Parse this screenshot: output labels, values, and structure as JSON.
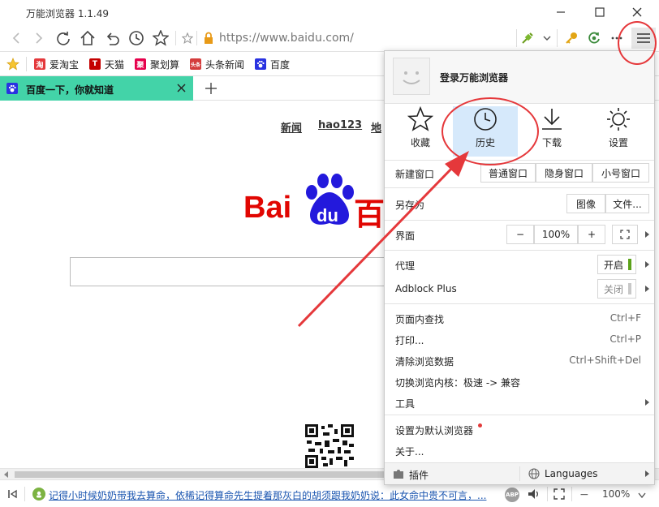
{
  "window": {
    "title": "万能浏览器 1.1.49"
  },
  "nav": {
    "url": "https://www.baidu.com/"
  },
  "bookmarks": [
    {
      "label": "爱淘宝",
      "icon": "taobao-icon",
      "glyph": "淘",
      "color": "#e4393c"
    },
    {
      "label": "天猫",
      "icon": "tmall-icon",
      "glyph": "T",
      "color": "#c40000"
    },
    {
      "label": "聚划算",
      "icon": "juhuasuan-icon",
      "glyph": "聚",
      "color": "#e6004c"
    },
    {
      "label": "头条新闻",
      "icon": "toutiao-icon",
      "glyph": "头条",
      "color": "#d43d3d"
    },
    {
      "label": "百度",
      "icon": "baidu-paw-icon",
      "glyph": "",
      "color": "#2932e1"
    }
  ],
  "tab": {
    "title": "百度一下，你就知道"
  },
  "page": {
    "links": [
      "新闻",
      "hao123",
      "地"
    ],
    "logo_text_left": "Bai",
    "logo_text_du": "du",
    "logo_text_right": "百"
  },
  "status": {
    "news": "记得小时候奶奶带我去算命，依稀记得算命先生提着那灰白的胡须跟我奶奶说：此女命中贵不可言，...",
    "zoom": "100%"
  },
  "menu": {
    "login": "登录万能浏览器",
    "quick": [
      {
        "label": "收藏",
        "icon": "star-icon"
      },
      {
        "label": "历史",
        "icon": "clock-icon"
      },
      {
        "label": "下载",
        "icon": "download-icon"
      },
      {
        "label": "设置",
        "icon": "sun-gear-icon"
      }
    ],
    "new_window_label": "新建窗口",
    "new_window_opts": [
      "普通窗口",
      "隐身窗口",
      "小号窗口"
    ],
    "save_as_label": "另存为",
    "save_as_opts": [
      "图像",
      "文件..."
    ],
    "interface_label": "界面",
    "zoom_minus": "−",
    "zoom_value": "100%",
    "zoom_plus": "+",
    "proxy_label": "代理",
    "proxy_state": "开启",
    "adblock_label": "Adblock Plus",
    "adblock_state": "关闭",
    "find_label": "页面内查找",
    "find_shortcut": "Ctrl+F",
    "print_label": "打印...",
    "print_shortcut": "Ctrl+P",
    "clear_label": "清除浏览数据",
    "clear_shortcut": "Ctrl+Shift+Del",
    "engine_label": "切换浏览内核：极速 -> 兼容",
    "tools_label": "工具",
    "default_label": "设置为默认浏览器",
    "about_label": "关于...",
    "plugins_label": "插件",
    "languages_label": "Languages"
  }
}
